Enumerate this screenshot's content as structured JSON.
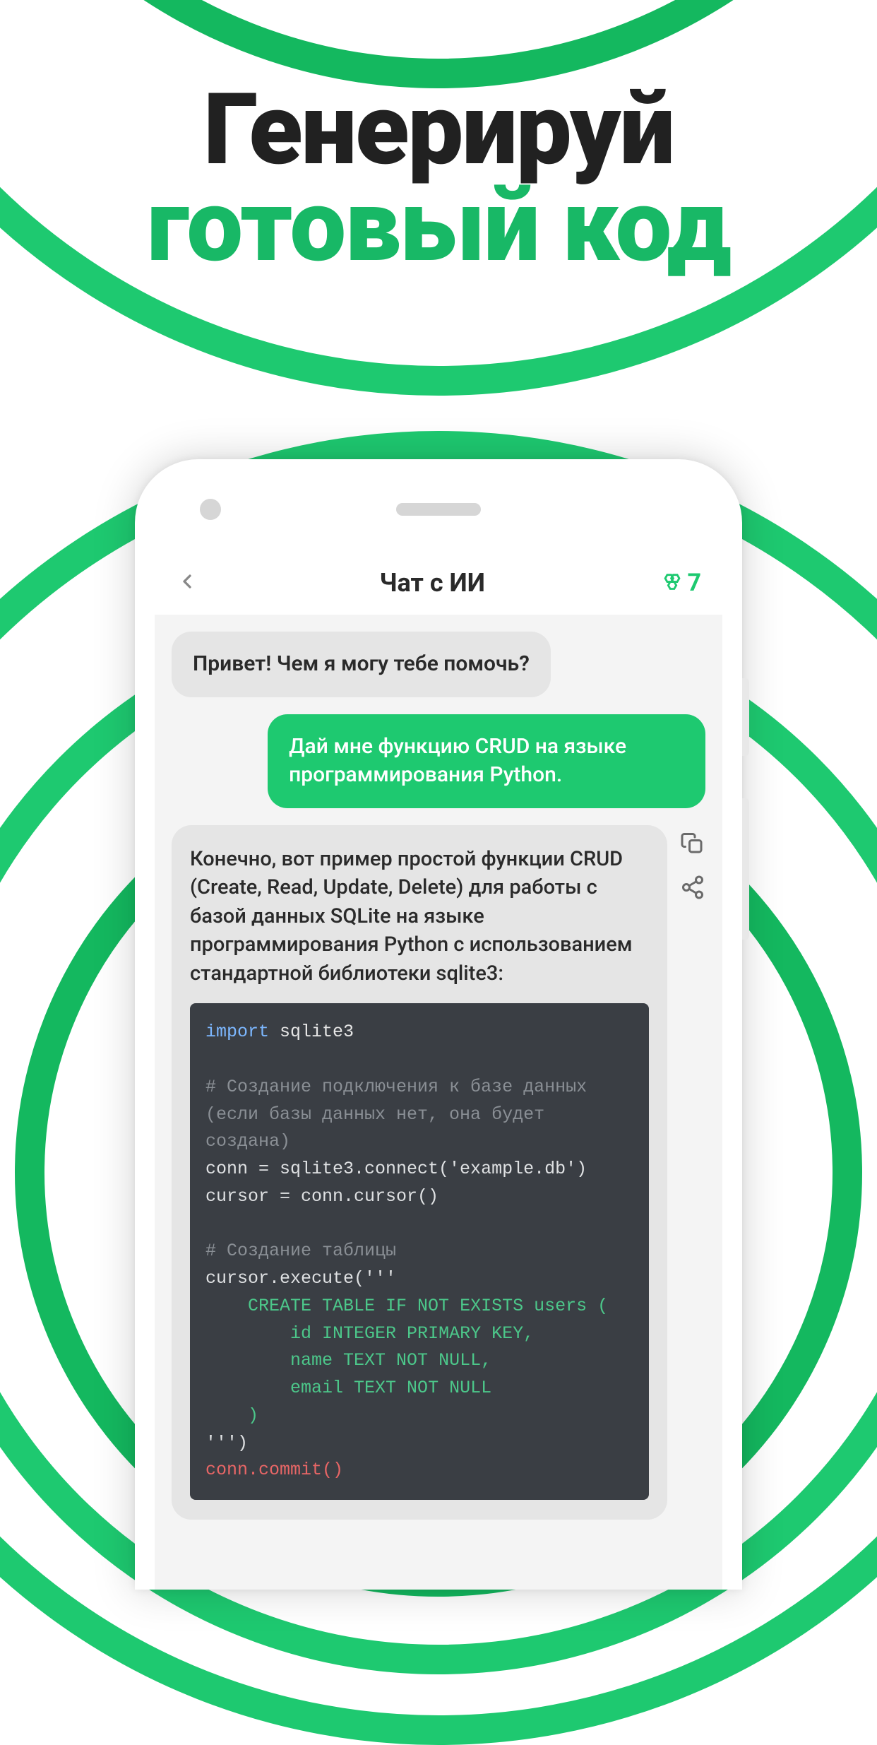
{
  "headline": {
    "line1": "Генерируй",
    "line2": "готовый код"
  },
  "header": {
    "title": "Чат с ИИ",
    "points": "7"
  },
  "chat": {
    "greeting": "Привет! Чем я могу тебе помочь?",
    "userMsg": "Дай мне функцию CRUD на языке программирования Python.",
    "replyIntro": "Конечно, вот пример простой функции CRUD (Create, Read, Update, Delete) для работы с базой данных SQLite на языке программирования Python с использованием стандартной библиотеки sqlite3:",
    "code": {
      "import_kw": "import",
      "import_mod": "sqlite3",
      "comment1": "# Создание подключения к базе данных (если базы данных нет, она будет создана)",
      "conn_line": "conn = sqlite3.connect('example.db')",
      "cursor_line": "cursor = conn.cursor()",
      "comment2": "# Создание таблицы",
      "exec_line": "cursor.execute('''",
      "sql": "    CREATE TABLE IF NOT EXISTS users (\n        id INTEGER PRIMARY KEY,\n        name TEXT NOT NULL,\n        email TEXT NOT NULL\n    )",
      "exec_close": "''')",
      "commit": "conn.commit()"
    }
  }
}
